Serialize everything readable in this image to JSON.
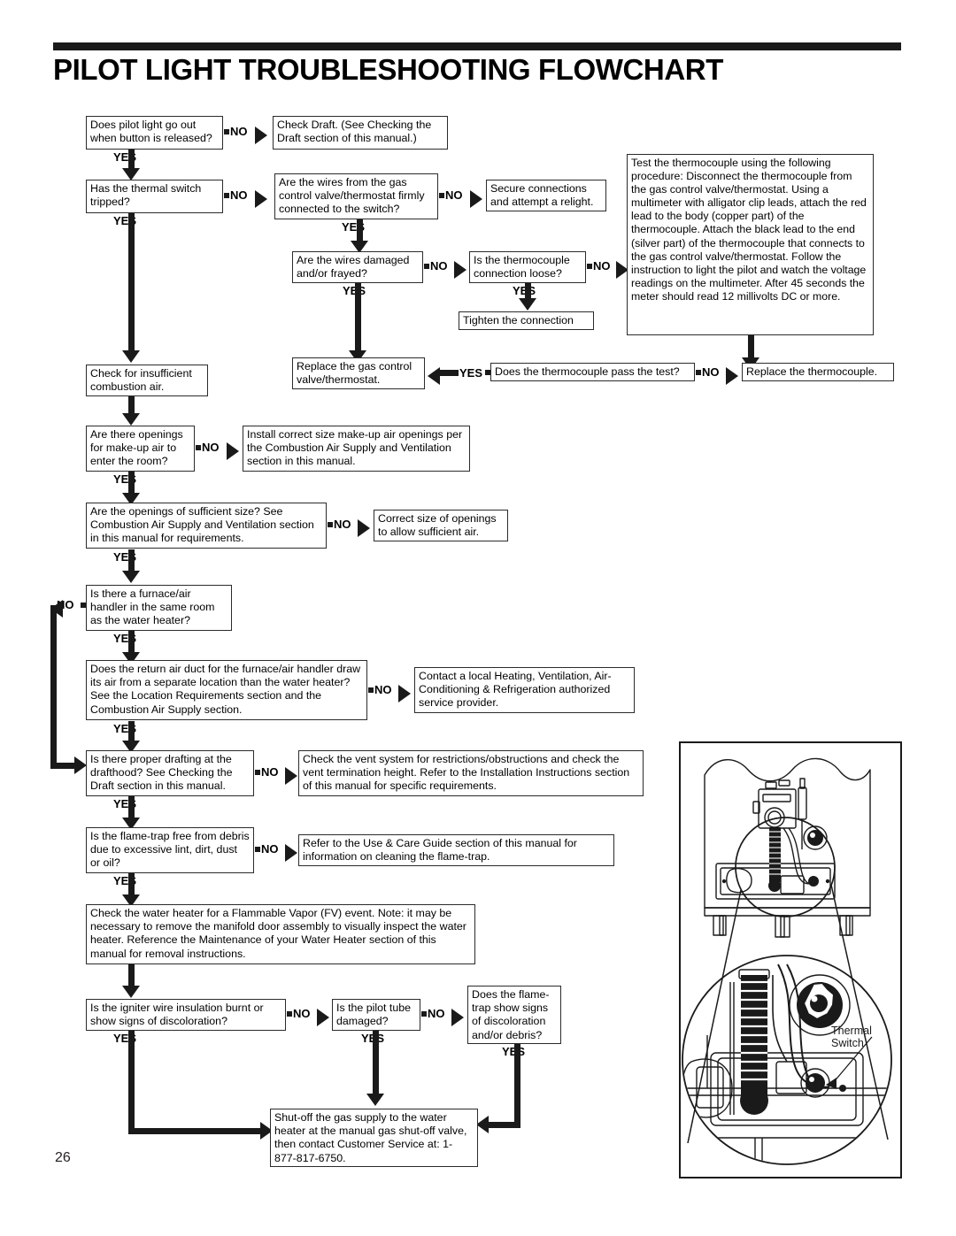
{
  "header": {
    "title": "PILOT LIGHT TROUBLESHOOTING FLOWCHART"
  },
  "page_number": "26",
  "labels": {
    "yes": "YES",
    "no": "NO"
  },
  "illustration": {
    "callout_label_line1": "Thermal",
    "callout_label_line2": "Switch"
  },
  "boxes": {
    "b1": "Does pilot light go out when button is released?",
    "b2": "Check Draft. (See Checking the Draft section of this manual.)",
    "b3": "Has the thermal switch tripped?",
    "b4": "Are the wires from the gas control valve/thermostat firmly connected to the switch?",
    "b5": "Secure connections and attempt a relight.",
    "b6": "Are the wires damaged and/or frayed?",
    "b7": "Is the thermocouple connection loose?",
    "b8": "Test the thermocouple using the following procedure: Disconnect the thermocouple from the gas control valve/thermostat. Using a multimeter with alligator clip leads, attach the red lead to the body (copper part) of the thermocouple. Attach the black lead to the end (silver part) of the thermocouple that connects to the gas control valve/thermostat. Follow the instruction to light the pilot and watch the voltage readings on the multimeter. After 45 seconds the meter should read 12 millivolts DC or more.",
    "b9": "Tighten the connection",
    "b10": "Replace the gas control valve/thermostat.",
    "b11": "Does the thermocouple pass the test?",
    "b12": "Replace the thermocouple.",
    "b13": "Check for insufficient combustion air.",
    "b14": "Are there openings for make-up air to enter the room?",
    "b15": "Install correct size make-up air openings per the Combustion Air Supply and Ventilation section in this manual.",
    "b16": "Are the openings of sufficient size? See Combustion Air Supply and Ventilation section in this manual for requirements.",
    "b17": "Correct size of openings to allow sufficient air.",
    "b18": "Is there a furnace/air handler in the same room as the water heater?",
    "b19": "Does the return air duct for the furnace/air handler draw its air from a separate location than the water heater? See the Location Requirements section and the Combustion Air Supply section.",
    "b20": "Contact a local Heating, Ventilation, Air-Conditioning & Refrigeration authorized service provider.",
    "b21": "Is there proper drafting at the drafthood? See Checking the Draft section in this manual.",
    "b22": "Check the vent system for restrictions/obstructions and check the vent termination height. Refer to the Installation Instructions section of this manual for specific requirements.",
    "b23": "Is the flame-trap free from debris due to excessive lint, dirt, dust or oil?",
    "b24": "Refer to the Use & Care Guide section of this manual for information on cleaning the flame-trap.",
    "b25": "Check the water heater for a Flammable Vapor (FV) event. Note: it may be necessary to remove the manifold door assembly to visually inspect the water heater. Reference the Maintenance of your Water Heater section of this manual for removal instructions.",
    "b26": "Is the igniter wire insulation burnt or show signs of discoloration?",
    "b27": "Is the pilot tube damaged?",
    "b28": "Does the flame-trap show signs of discoloration and/or debris?",
    "b29": "Shut-off the gas supply to the water heater at the manual gas shut-off valve, then contact Customer Service at: 1-877-817-6750."
  }
}
